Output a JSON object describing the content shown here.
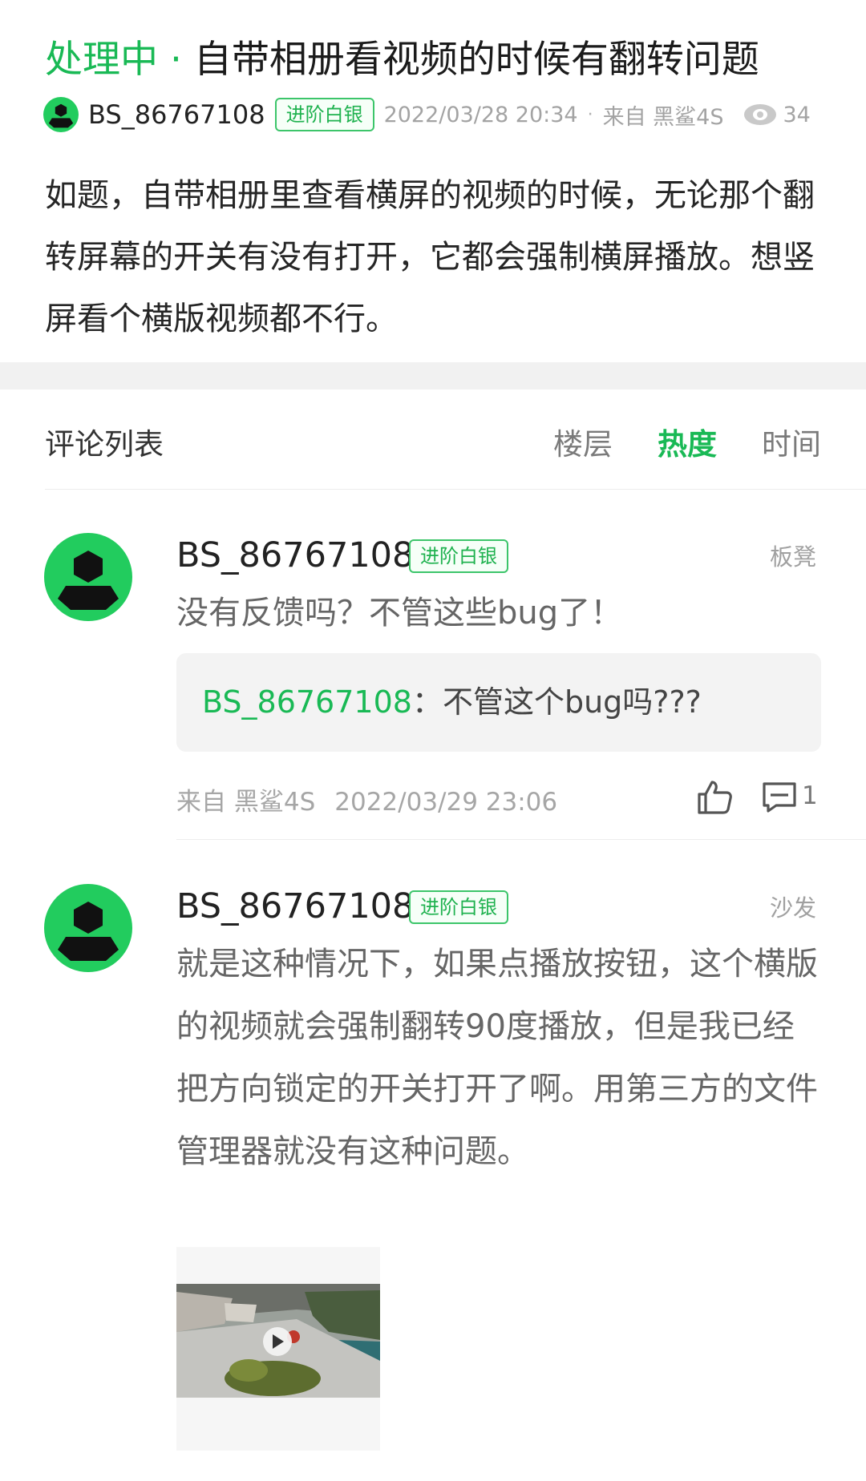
{
  "post": {
    "status": "处理中",
    "separator": " · ",
    "title": "自带相册看视频的时候有翻转问题",
    "author": "BS_86767108",
    "badge": "进阶白银",
    "date": "2022/03/28 20:34",
    "meta_dot": "·",
    "from": "来自 黑鲨4S",
    "views": "34",
    "body": "如题，自带相册里查看横屏的视频的时候，无论那个翻转屏幕的开关有没有打开，它都会强制横屏播放。想竖屏看个横版视频都不行。"
  },
  "comments_header": {
    "title": "评论列表",
    "tabs": [
      "楼层",
      "热度",
      "时间"
    ],
    "active_tab": "热度"
  },
  "comments": [
    {
      "author": "BS_86767108",
      "badge": "进阶白银",
      "floor": "板凳",
      "text": "没有反馈吗？不管这些bug了！",
      "reply": {
        "user": "BS_86767108",
        "colon": "：",
        "text": "不管这个bug吗???"
      },
      "from": "来自 黑鲨4S",
      "date": "2022/03/29 23:06",
      "reply_count": "1"
    },
    {
      "author": "BS_86767108",
      "badge": "进阶白银",
      "floor": "沙发",
      "text": "就是这种情况下，如果点播放按钮，这个横版的视频就会强制翻转90度播放，但是我已经把方向锁定的开关打开了啊。用第三方的文件管理器就没有这种问题。"
    }
  ],
  "colors": {
    "accent": "#19b955",
    "avatar": "#22cc5e",
    "section_gap": "#f1f1f1",
    "quote_bg": "#f3f3f3"
  },
  "icons": [
    "avatar-icon",
    "eye-icon",
    "like-icon",
    "reply-icon",
    "play-icon"
  ]
}
